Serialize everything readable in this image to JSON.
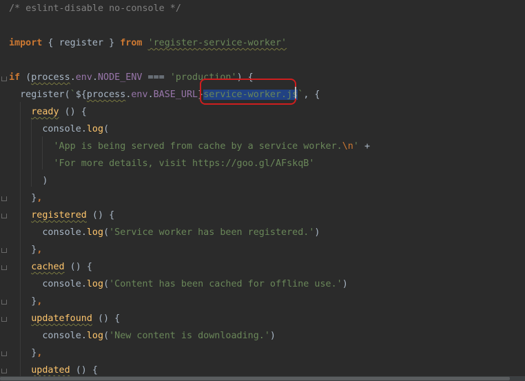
{
  "editor": {
    "language": "javascript",
    "colors": {
      "background": "#2b2b2b",
      "comment": "#808080",
      "keyword": "#cc7832",
      "string": "#6a8759",
      "function": "#ffc66d",
      "property": "#9876aa",
      "plain": "#a9b7c6",
      "selection": "#214283",
      "annotation": "#d01e1e"
    },
    "lines": {
      "l1": {
        "comment": "/* eslint-disable no-console */"
      },
      "l3": {
        "kw_import": "import",
        "brace_open": " { ",
        "name": "register",
        "brace_close": " } ",
        "kw_from": "from",
        "space": " ",
        "module": "'register-service-worker'"
      },
      "l5": {
        "kw_if": "if",
        "paren": " (",
        "process": "process",
        "dot1": ".",
        "env": "env",
        "dot2": ".",
        "node_env": "NODE_ENV",
        "op": " === ",
        "value": "'production'",
        "close": ") {"
      },
      "l6": {
        "indent": "  ",
        "fn": "register",
        "open": "(",
        "tpl_start": "`",
        "interp_open": "${",
        "process": "process",
        "dot1": ".",
        "env": "env",
        "dot2": ".",
        "base_url": "BASE_URL",
        "interp_close": "}",
        "selected": "service-worker.js",
        "tpl_end": "`",
        "rest": ", {"
      },
      "l7": {
        "indent": "    ",
        "name": "ready",
        "rest": " () {"
      },
      "l8": {
        "indent": "      ",
        "obj": "console",
        "dot": ".",
        "method": "log",
        "rest": "("
      },
      "l9": {
        "indent": "        ",
        "str": "'App is being served from cache by a service worker.",
        "esc": "\\n",
        "str_end": "'",
        "rest": " +"
      },
      "l10": {
        "indent": "        ",
        "str": "'For more details, visit https://goo.gl/AFskqB'"
      },
      "l11": {
        "indent": "      ",
        "rest": ")"
      },
      "l12": {
        "indent": "    ",
        "brace": "}",
        "comma": ","
      },
      "l13": {
        "indent": "    ",
        "name": "registered",
        "rest": " () {"
      },
      "l14": {
        "indent": "      ",
        "obj": "console",
        "dot": ".",
        "method": "log",
        "open": "(",
        "str": "'Service worker has been registered.'",
        "close": ")"
      },
      "l15": {
        "indent": "    ",
        "brace": "}",
        "comma": ","
      },
      "l16": {
        "indent": "    ",
        "name": "cached",
        "rest": " () {"
      },
      "l17": {
        "indent": "      ",
        "obj": "console",
        "dot": ".",
        "method": "log",
        "open": "(",
        "str": "'Content has been cached for offline use.'",
        "close": ")"
      },
      "l18": {
        "indent": "    ",
        "brace": "}",
        "comma": ","
      },
      "l19": {
        "indent": "    ",
        "name": "updatefound",
        "rest": " () {"
      },
      "l20": {
        "indent": "      ",
        "obj": "console",
        "dot": ".",
        "method": "log",
        "open": "(",
        "str": "'New content is downloading.'",
        "close": ")"
      },
      "l21": {
        "indent": "    ",
        "brace": "}",
        "comma": ","
      },
      "l22": {
        "indent": "    ",
        "name": "updated",
        "rest": " () {"
      }
    }
  }
}
